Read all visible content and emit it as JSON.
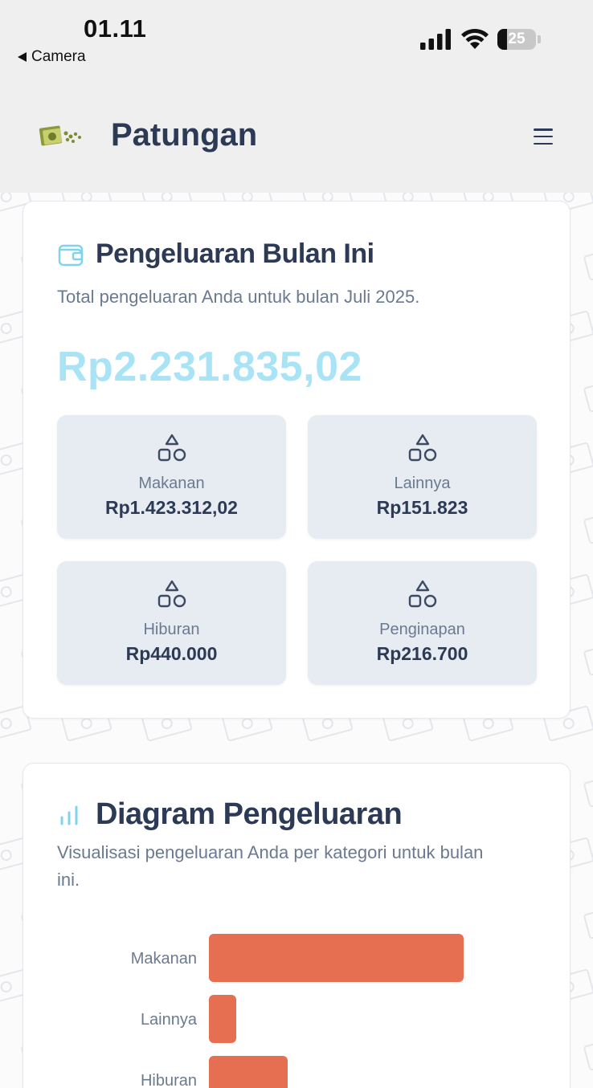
{
  "status_bar": {
    "time": "01.11",
    "back_label": "Camera",
    "battery_level": "25",
    "battery_percent": 25
  },
  "header": {
    "title": "Patungan",
    "menu_icon": "hamburger-menu-icon",
    "logo_icon": "money-logo-icon"
  },
  "summary": {
    "icon": "wallet-icon",
    "title": "Pengeluaran Bulan Ini",
    "description": "Total pengeluaran Anda untuk bulan Juli 2025.",
    "total": "Rp2.231.835,02",
    "categories": [
      {
        "name": "Makanan",
        "amount": "Rp1.423.312,02",
        "icon": "shapes-icon"
      },
      {
        "name": "Lainnya",
        "amount": "Rp151.823",
        "icon": "shapes-icon"
      },
      {
        "name": "Hiburan",
        "amount": "Rp440.000",
        "icon": "shapes-icon"
      },
      {
        "name": "Penginapan",
        "amount": "Rp216.700",
        "icon": "shapes-icon"
      }
    ]
  },
  "diagram": {
    "icon": "bar-chart-icon",
    "title": "Diagram Pengeluaran",
    "description": "Visualisasi pengeluaran Anda per kategori untuk bulan ini."
  },
  "chart_data": {
    "type": "bar",
    "orientation": "horizontal",
    "categories": [
      "Makanan",
      "Lainnya",
      "Hiburan"
    ],
    "values": [
      1423312.02,
      151823,
      440000
    ],
    "bar_color": "#e76f51"
  },
  "colors": {
    "accent_total": "#a9e3f6",
    "accent_icon": "#7fd3ee",
    "title_text": "#2d3a55",
    "muted_text": "#6b7a90",
    "tile_bg": "#e7ebf2",
    "bar": "#e76f51"
  }
}
